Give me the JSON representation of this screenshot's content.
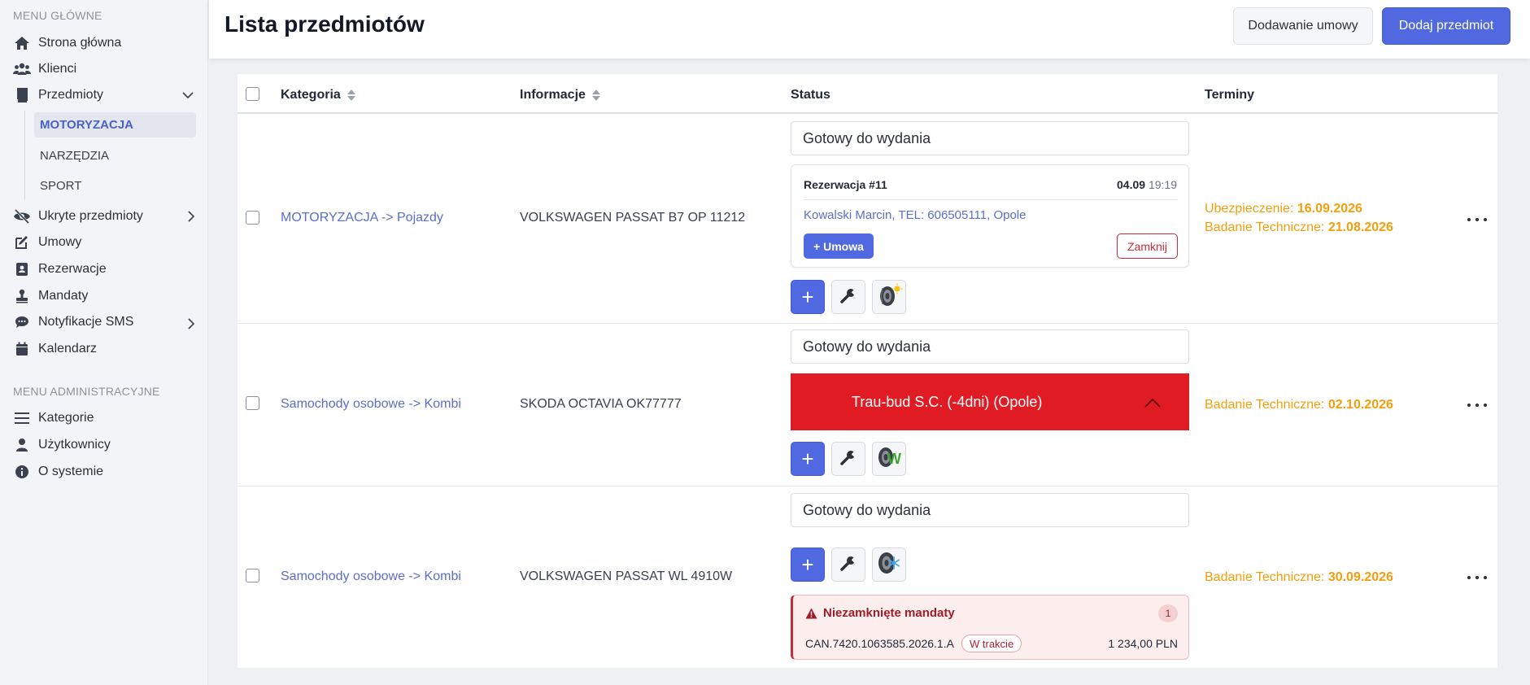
{
  "sidebar": {
    "main_section": "MENU GŁÓWNE",
    "admin_section": "MENU ADMINISTRACYJNE",
    "items": {
      "home": "Strona główna",
      "clients": "Klienci",
      "items": "Przedmioty",
      "hidden": "Ukryte przedmioty",
      "contracts": "Umowy",
      "reservations": "Rezerwacje",
      "fines": "Mandaty",
      "sms": "Notyfikacje SMS",
      "calendar": "Kalendarz",
      "categories": "Kategorie",
      "users": "Użytkownicy",
      "about": "O systemie"
    },
    "subitems": [
      "MOTORYZACJA",
      "NARZĘDZIA",
      "SPORT"
    ]
  },
  "header": {
    "title": "Lista przedmiotów",
    "add_contract": "Dodawanie umowy",
    "add_item": "Dodaj przedmiot"
  },
  "table": {
    "columns": {
      "category": "Kategoria",
      "info": "Informacje",
      "status": "Status",
      "terms": "Terminy"
    },
    "rows": [
      {
        "category": "MOTORYZACJA -> Pojazdy",
        "info": "VOLKSWAGEN PASSAT B7 OP 11212",
        "status": "Gotowy do wydania",
        "reservation": {
          "title": "Rezerwacja #11",
          "date": "04.09",
          "time": "19:19",
          "client": "Kowalski Marcin, TEL: 606505111, Opole",
          "contract_btn": "+ Umowa",
          "close_btn": "Zamknij"
        },
        "terms": [
          {
            "label": "Ubezpieczenie: ",
            "date": "16.09.2026"
          },
          {
            "label": "Badanie Techniczne: ",
            "date": "21.08.2026"
          }
        ]
      },
      {
        "category": "Samochody osobowe -> Kombi",
        "info": "SKODA OCTAVIA OK77777",
        "status": "Gotowy do wydania",
        "rental": "Trau-bud S.C. (-4dni) (Opole)",
        "terms": [
          {
            "label": "Badanie Techniczne: ",
            "date": "02.10.2026"
          }
        ]
      },
      {
        "category": "Samochody osobowe -> Kombi",
        "info": "VOLKSWAGEN PASSAT WL 4910W",
        "status": "Gotowy do wydania",
        "fines": {
          "title": "Niezamknięte mandaty",
          "count": "1",
          "code": "CAN.7420.1063585.2026.1.A",
          "state": "W trakcie",
          "amount": "1 234,00 PLN"
        },
        "terms": [
          {
            "label": "Badanie Techniczne: ",
            "date": "30.09.2026"
          }
        ]
      }
    ]
  },
  "icons": {
    "plus": "+",
    "summer_tire": "tire-sun-icon",
    "allseason_tire": "tire-w-icon",
    "winter_tire": "tire-snowflake-icon"
  },
  "colors": {
    "accent": "#5169e0",
    "link": "#5a6fc9",
    "term": "#f59e0b",
    "rental_alert": "#e01b24",
    "danger": "#c72c3a"
  }
}
